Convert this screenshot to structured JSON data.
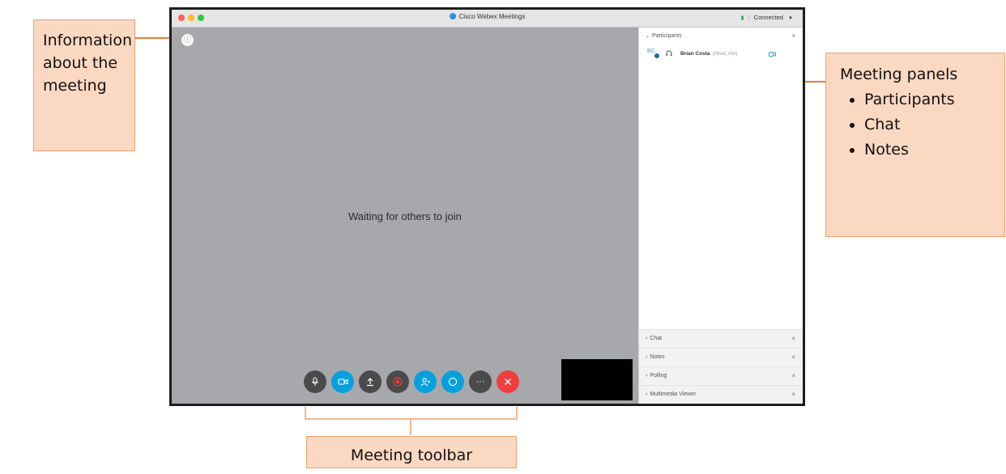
{
  "callouts": {
    "info": "Information about the meeting",
    "panels": {
      "title": "Meeting panels",
      "items": [
        "Participants",
        "Chat",
        "Notes"
      ]
    },
    "toolbar": "Meeting toolbar"
  },
  "window": {
    "title": "Cisco Webex Meetings",
    "status": "Connected"
  },
  "stage": {
    "info_icon": "info-icon",
    "waiting_text": "Waiting for others to join"
  },
  "toolbar_buttons": [
    {
      "name": "mute-button",
      "icon": "microphone-icon",
      "style": "dark"
    },
    {
      "name": "video-button",
      "icon": "camera-icon",
      "style": "blue"
    },
    {
      "name": "share-button",
      "icon": "share-icon",
      "style": "dark"
    },
    {
      "name": "record-button",
      "icon": "record-icon",
      "style": "dark"
    },
    {
      "name": "participants-button",
      "icon": "people-icon",
      "style": "blue"
    },
    {
      "name": "chat-button",
      "icon": "chat-bubble-icon",
      "style": "blue"
    },
    {
      "name": "more-button",
      "icon": "ellipsis-icon",
      "style": "dark"
    },
    {
      "name": "leave-button",
      "icon": "close-icon",
      "style": "red"
    }
  ],
  "panels": {
    "participants": {
      "title": "Participants",
      "entries": [
        {
          "initials": "BC",
          "name": "Brian Costa",
          "role": "(Host, me)"
        }
      ]
    },
    "collapsed": [
      "Chat",
      "Notes",
      "Polling",
      "Multimedia Viewer"
    ]
  },
  "colors": {
    "callout_fill": "#fbd8c2",
    "callout_border": "#f0a070",
    "arrow": "#ef7a35",
    "stage": "#a7a8ab",
    "accent_blue": "#07a0de",
    "leave_red": "#ef3e3f"
  }
}
